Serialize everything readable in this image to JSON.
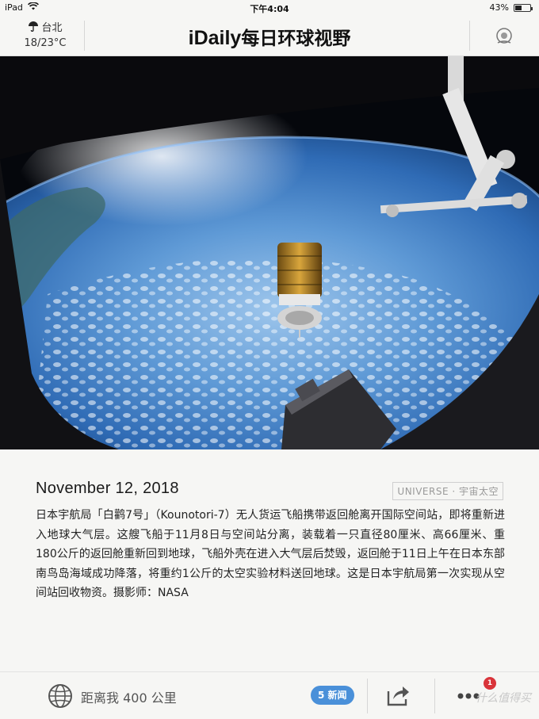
{
  "status_bar": {
    "device": "iPad",
    "time": "下午4:04",
    "battery": "43%",
    "battery_level": 0.43
  },
  "header": {
    "weather_city": "台北",
    "weather_temp": "18/23°C",
    "logo_latin": "iDaily",
    "logo_cn": "每日环球视野"
  },
  "article": {
    "date": "November 12, 2018",
    "category": "UNIVERSE · 宇宙太空",
    "body": "日本宇航局「白鹳7号」（Kounotori-7）无人货运飞船携带返回舱离开国际空间站，即将重新进入地球大气层。这艘飞船于11月8日与空间站分离，装载着一只直径80厘米、高66厘米、重180公斤的返回舱重新回到地球，飞船外壳在进入大气层后焚毁，返回舱于11日上午在日本东部南鸟岛海域成功降落，将重约1公斤的太空实验材料送回地球。这是日本宇航局第一次实现从空间站回收物资。摄影师：NASA"
  },
  "toolbar": {
    "distance": "距离我 400 公里",
    "news_count": "5 新闻",
    "notification_badge": "1",
    "watermark": "什么值得买"
  },
  "icons": {
    "wifi": "wifi-icon",
    "weather": "umbrella-icon",
    "view": "eye-icon",
    "globe": "globe-icon",
    "share": "share-icon",
    "more": "more-icon"
  },
  "colors": {
    "news_pill": "#4a90d9",
    "badge": "#d9343a"
  }
}
